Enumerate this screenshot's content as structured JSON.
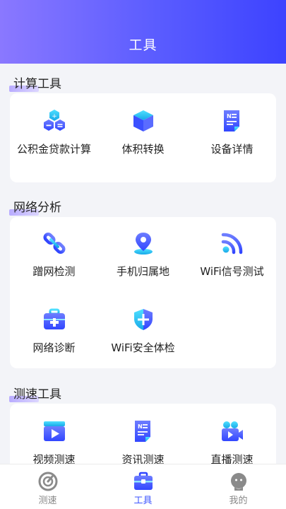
{
  "header": {
    "title": "工具"
  },
  "sections": [
    {
      "title": "计算工具",
      "items": [
        {
          "label": "公积金贷款计算",
          "icon": "hexagon-calculator-icon"
        },
        {
          "label": "体积转换",
          "icon": "cube-icon"
        },
        {
          "label": "设备详情",
          "icon": "document-icon"
        }
      ]
    },
    {
      "title": "网络分析",
      "items": [
        {
          "label": "蹭网检测",
          "icon": "link-icon"
        },
        {
          "label": "手机归属地",
          "icon": "location-pin-icon"
        },
        {
          "label": "WiFi信号测试",
          "icon": "wifi-signal-icon"
        },
        {
          "label": "网络诊断",
          "icon": "medical-kit-icon"
        },
        {
          "label": "WiFi安全体检",
          "icon": "shield-icon"
        }
      ]
    },
    {
      "title": "测速工具",
      "items": [
        {
          "label": "视频测速",
          "icon": "video-clapper-icon"
        },
        {
          "label": "资讯测速",
          "icon": "news-document-icon"
        },
        {
          "label": "直播测速",
          "icon": "live-camera-icon"
        }
      ]
    }
  ],
  "tabbar": {
    "tabs": [
      {
        "label": "测速",
        "icon": "speedometer-icon",
        "active": false
      },
      {
        "label": "工具",
        "icon": "toolbox-icon",
        "active": true
      },
      {
        "label": "我的",
        "icon": "user-avatar-icon",
        "active": false
      }
    ]
  },
  "colors": {
    "accent": "#3d55ff",
    "header_start": "#8a78ff",
    "header_end": "#3d43ff",
    "icon_blue": "#4a5dff",
    "icon_cyan": "#23c8f0"
  }
}
